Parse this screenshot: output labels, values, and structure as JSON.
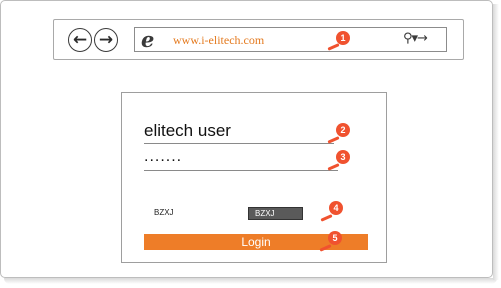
{
  "browser": {
    "back_icon": "left-arrow-icon",
    "forward_icon": "right-arrow-icon",
    "ie_icon": "e",
    "url": "www.i-elitech.com",
    "search_controls": "⚲▾→"
  },
  "login": {
    "username": "elitech user",
    "password_mask": ".......",
    "captcha_label": "BZXJ",
    "captcha_image_text": "BZXJ",
    "login_label": "Login"
  },
  "markers": [
    "1",
    "2",
    "3",
    "4",
    "5"
  ],
  "colors": {
    "accent_orange": "#ee7d28",
    "marker_red": "#f0522f",
    "url_orange": "#e47a1f"
  }
}
